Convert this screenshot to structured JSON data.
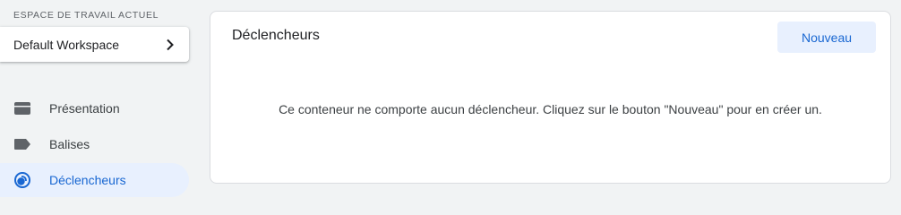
{
  "sidebar": {
    "workspace_label": "ESPACE DE TRAVAIL ACTUEL",
    "workspace_name": "Default Workspace",
    "items": [
      {
        "label": "Présentation",
        "icon": "folder-icon",
        "active": false
      },
      {
        "label": "Balises",
        "icon": "tag-icon",
        "active": false
      },
      {
        "label": "Déclencheurs",
        "icon": "trigger-icon",
        "active": true
      }
    ]
  },
  "main": {
    "title": "Déclencheurs",
    "new_button_label": "Nouveau",
    "empty_message": "Ce conteneur ne comporte aucun déclencheur. Cliquez sur le bouton \"Nouveau\" pour en créer un."
  },
  "colors": {
    "accent": "#1967d2",
    "active_bg": "#e8f0fe",
    "page_bg": "#f1f3f4",
    "icon_gray": "#5f6368"
  }
}
